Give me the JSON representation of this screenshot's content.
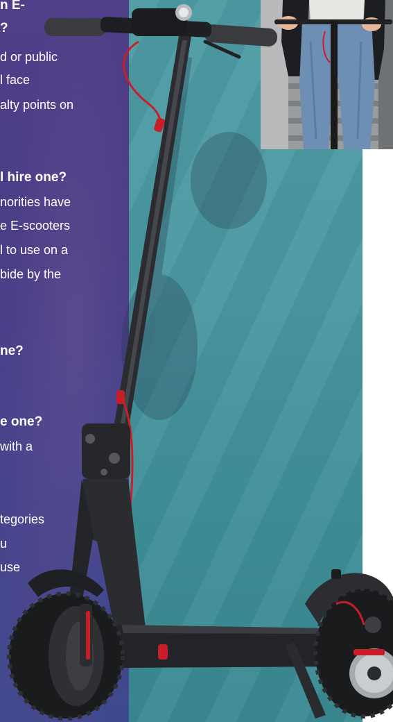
{
  "left_panel": {
    "q1_line1": "n E-",
    "q1_line2": "?",
    "a1_line1": "d or public",
    "a1_line2": "l face",
    "a1_line3": "alty points on",
    "q2": "l hire one?",
    "a2_line1": "norities have",
    "a2_line2": "e E-scooters",
    "a2_line3": "l to use on a",
    "a2_line4": "bide by the",
    "q3": "ne?",
    "q4": "e one?",
    "a4_line1": "with a",
    "a5_line1": "tegories",
    "a5_line2": "u",
    "a5_line3": "use"
  },
  "colors": {
    "left_panel_bg": "#4b3f88",
    "right_panel_bg": "#4a98a1",
    "scooter_body": "#2a2b2e",
    "accent_red": "#c81e2a"
  },
  "images": {
    "main": "electric-scooter",
    "inset": "person-riding-scooter-photo"
  }
}
